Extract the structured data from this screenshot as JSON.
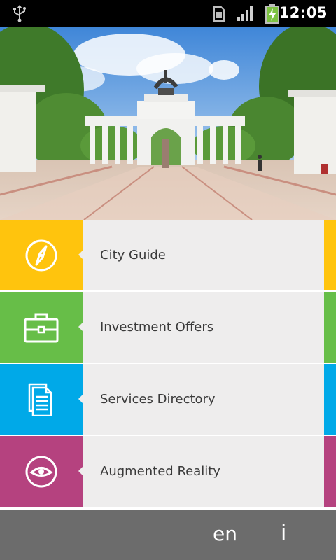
{
  "status_bar": {
    "time": "12:05",
    "icons": [
      "usb-icon",
      "sim-icon",
      "signal-icon",
      "battery-charging-icon"
    ]
  },
  "colors": {
    "yellow": "#ffc40d",
    "green": "#67be48",
    "blue": "#00a9e8",
    "magenta": "#b5427f",
    "row_bg": "#eeeded",
    "bottom_bar": "#6c6c6c"
  },
  "menu": {
    "items": [
      {
        "label": "City Guide",
        "icon": "compass-icon",
        "color": "#ffc40d"
      },
      {
        "label": "Investment Offers",
        "icon": "briefcase-icon",
        "color": "#67be48"
      },
      {
        "label": "Services Directory",
        "icon": "documents-icon",
        "color": "#00a9e8"
      },
      {
        "label": "Augmented Reality",
        "icon": "eye-icon",
        "color": "#b5427f"
      }
    ]
  },
  "bottom_bar": {
    "language": "en",
    "info": "i"
  }
}
